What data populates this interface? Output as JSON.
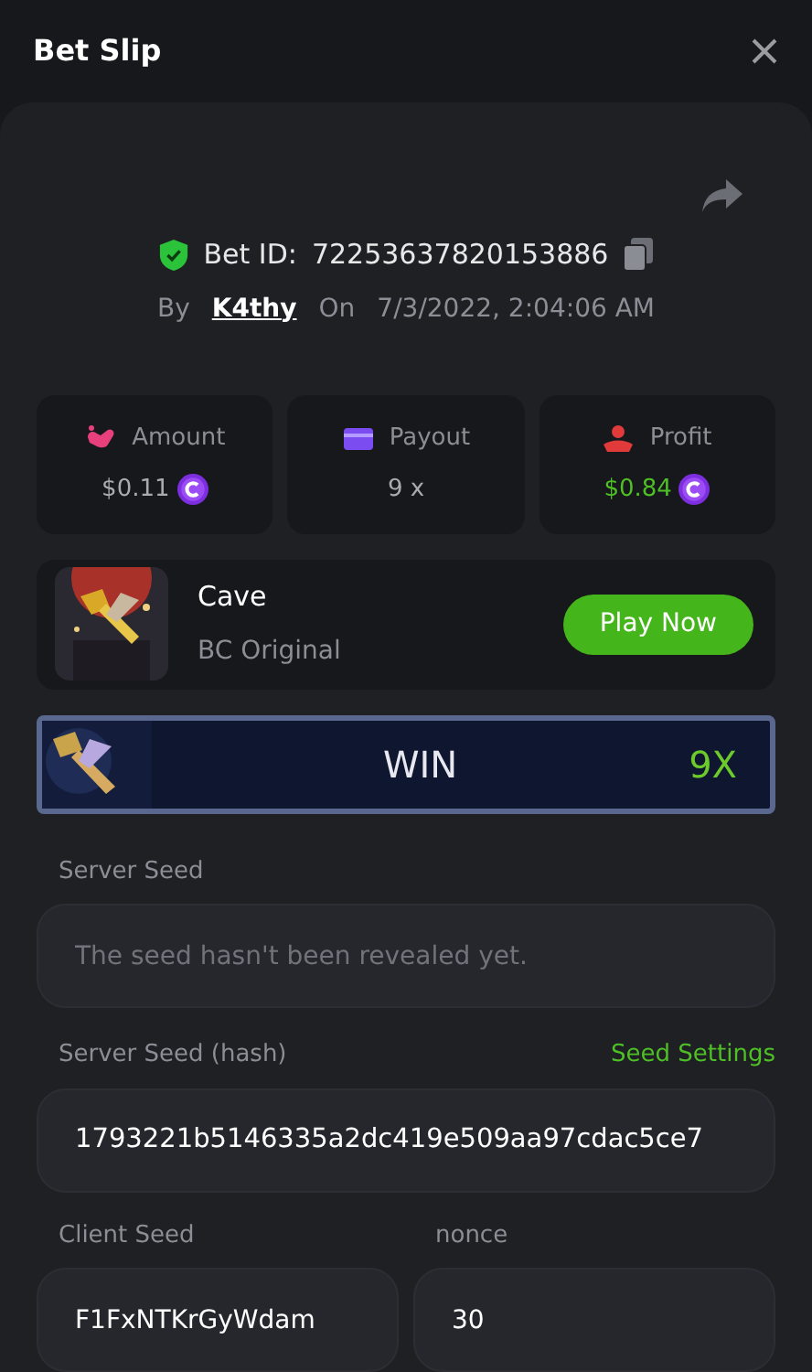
{
  "header": {
    "title": "Bet Slip"
  },
  "bet": {
    "id_label": "Bet ID:",
    "id": "72253637820153886",
    "by_label": "By",
    "user": "K4thy",
    "on_label": "On",
    "date": "7/3/2022, 2:04:06 AM",
    "verified": true
  },
  "stats": [
    {
      "kind": "amount",
      "label": "Amount",
      "value": "$0.11",
      "coin": true,
      "color": "#a9abb1"
    },
    {
      "kind": "payout",
      "label": "Payout",
      "value": "9 x",
      "coin": false,
      "color": "#a9abb1"
    },
    {
      "kind": "profit",
      "label": "Profit",
      "value": "$0.84",
      "coin": true,
      "color": "#4fbf26"
    }
  ],
  "game": {
    "name": "Cave",
    "provider": "BC Original",
    "button": "Play Now"
  },
  "result": {
    "label": "WIN",
    "multiplier": "9X"
  },
  "fields": [
    {
      "label": "Server Seed",
      "placeholder": "The seed hasn't been revealed yet."
    },
    {
      "label": "Server Seed (hash)",
      "value": "1793221b5146335a2dc419e509aa97cdac5ce7",
      "link": "Seed Settings"
    }
  ],
  "seed_pair": [
    {
      "label": "Client Seed",
      "value": "F1FxNTKrGyWdam"
    },
    {
      "label": "nonce",
      "value": "30"
    }
  ]
}
